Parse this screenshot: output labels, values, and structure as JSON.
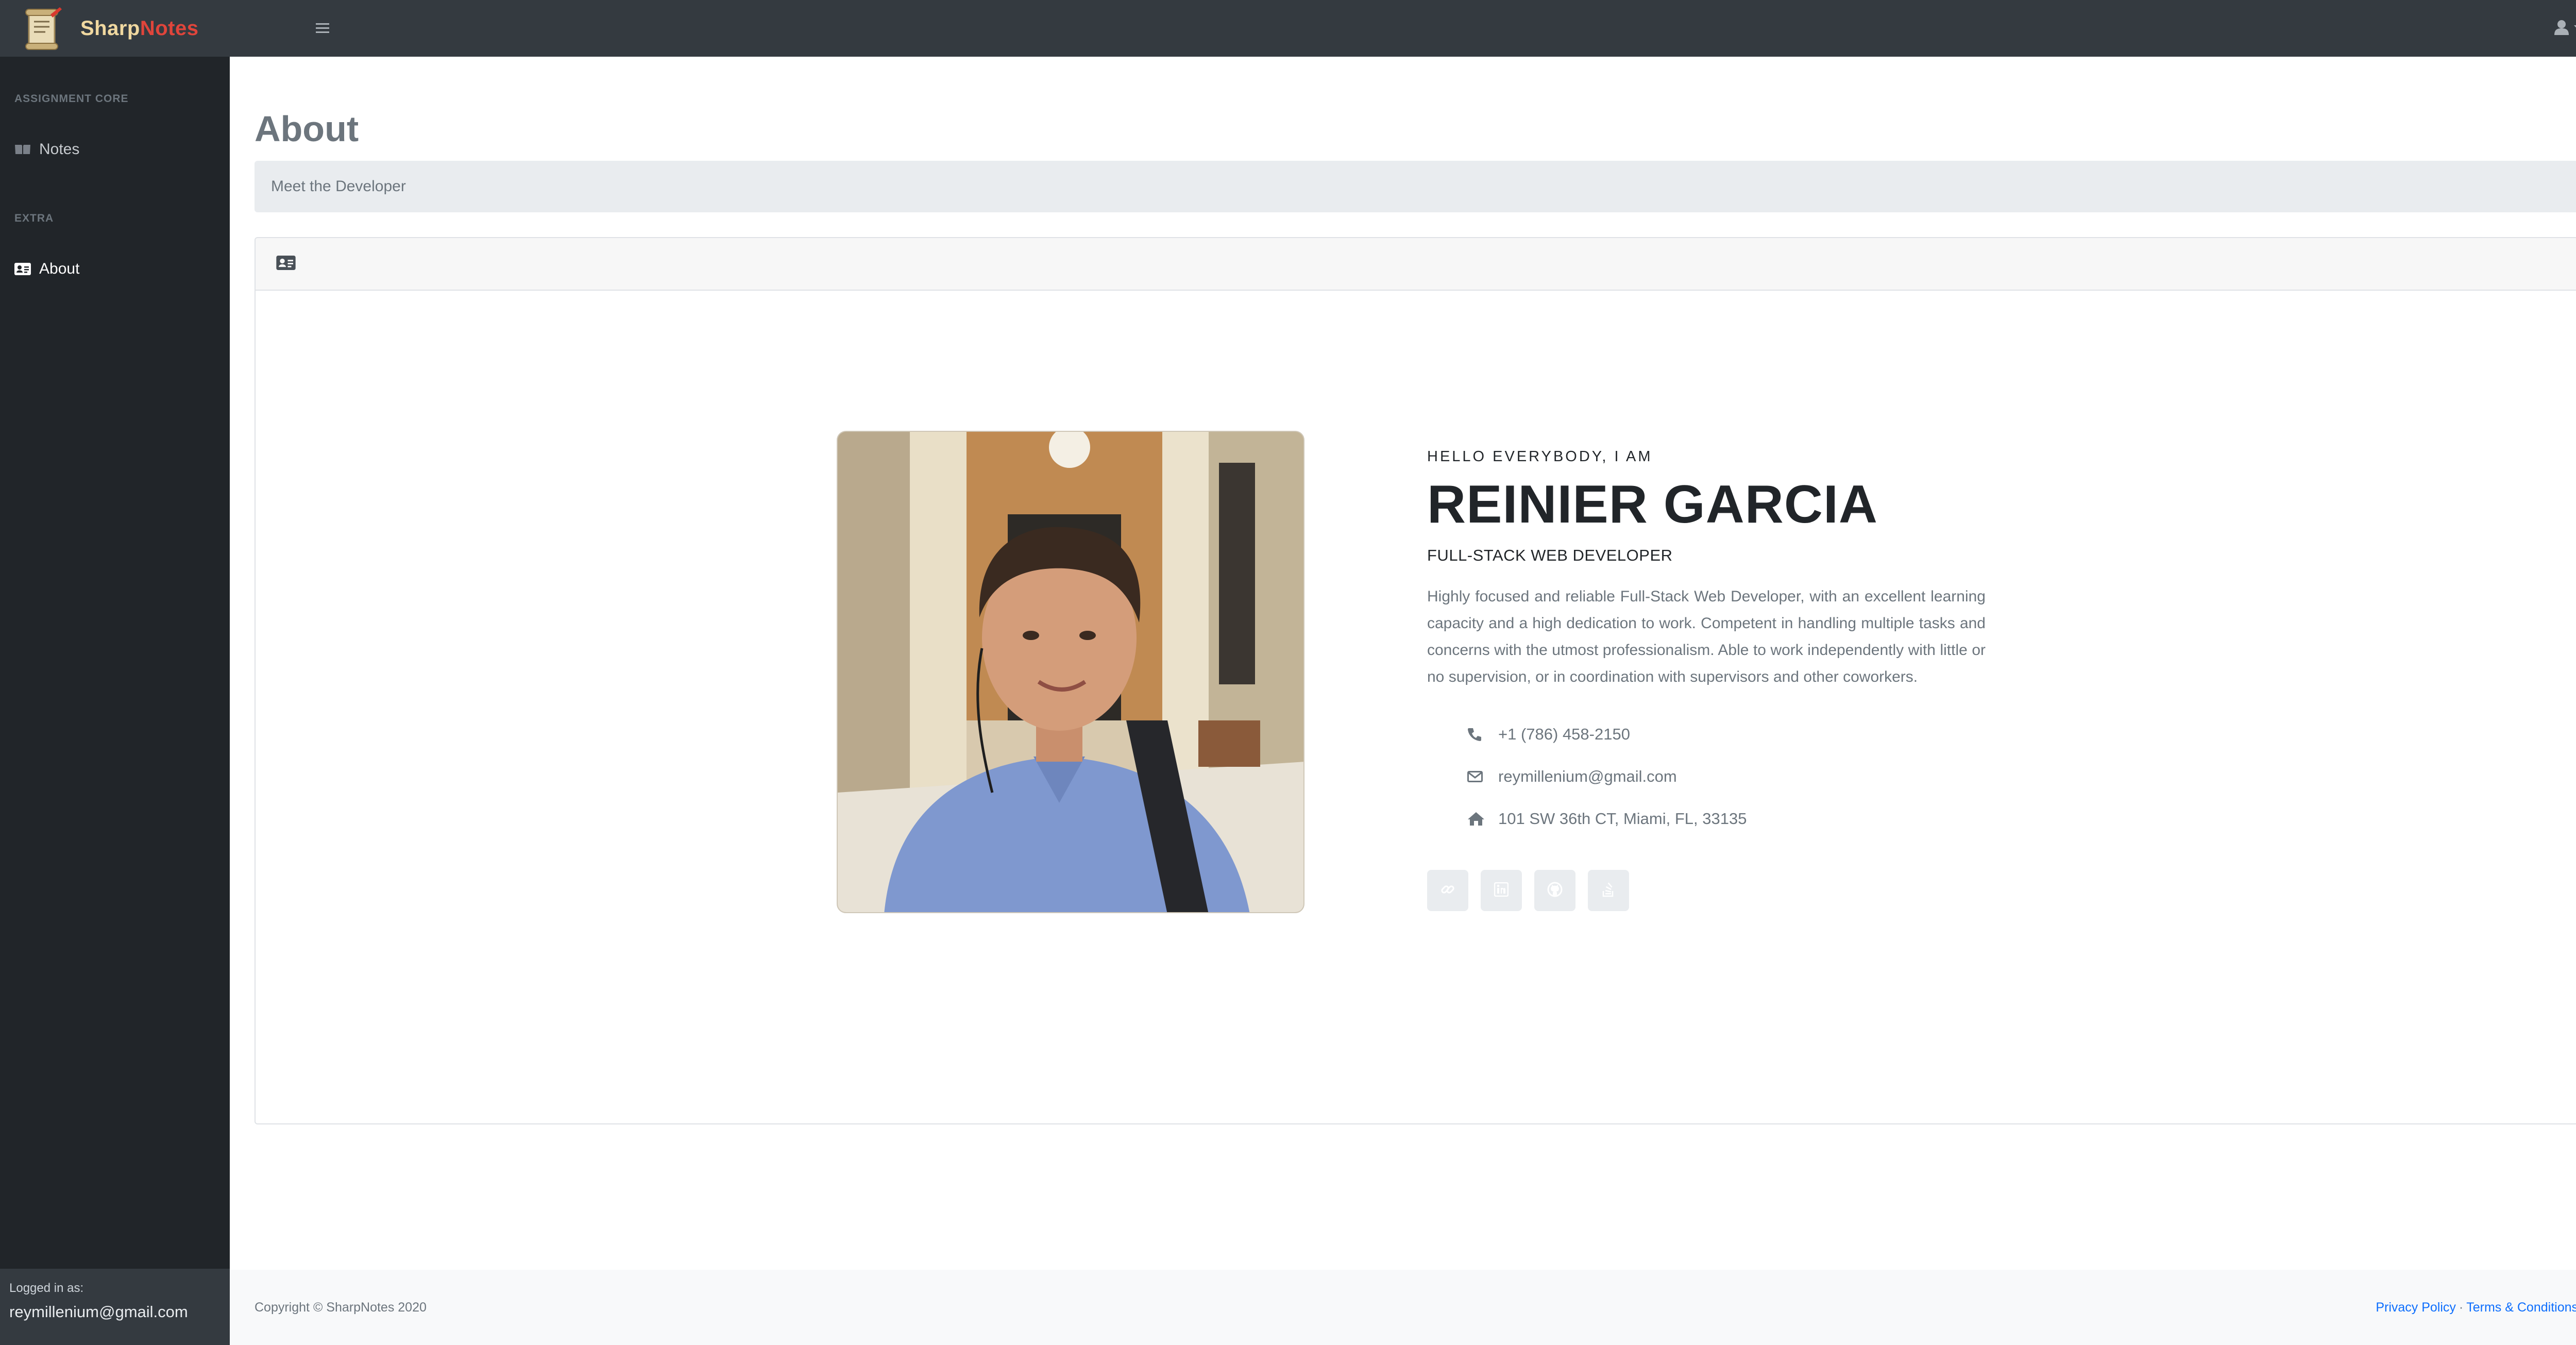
{
  "app": {
    "brand_part1": "Sharp",
    "brand_part2": "Notes",
    "brand_color_1": "#f0d8a0",
    "brand_color_2": "#e0453b",
    "icons": [
      "scroll-logo-icon",
      "hamburger-icon",
      "user-icon",
      "caret-down-icon"
    ]
  },
  "sidebar": {
    "section1": "ASSIGNMENT CORE",
    "section2": "EXTRA",
    "items": [
      {
        "label": "Notes",
        "icon": "book-icon"
      },
      {
        "label": "About",
        "icon": "id-card-icon",
        "active": true
      }
    ],
    "logged_label": "Logged in as:",
    "logged_user": "reymillenium@gmail.com"
  },
  "page": {
    "title": "About",
    "breadcrumb": "Meet the Developer",
    "card_header_icon": "id-card-icon"
  },
  "profile": {
    "greeting": "HELLO EVERYBODY, I AM",
    "name": "REINIER GARCIA",
    "role": "FULL-STACK WEB DEVELOPER",
    "description": "Highly focused and reliable Full-Stack Web Developer, with an excellent learning capacity and a high dedication to work. Competent in handling multiple tasks and concerns with the utmost professionalism. Able to work independently with little or no supervision, or in coordination with supervisors and other coworkers.",
    "phone": "+1 (786) 458-2150",
    "email": "reymillenium@gmail.com",
    "address": "101 SW 36th CT, Miami, FL, 33135",
    "socials": [
      "link-icon",
      "linkedin-icon",
      "github-icon",
      "stackoverflow-icon"
    ]
  },
  "footer": {
    "copyright": "Copyright © SharpNotes 2020",
    "privacy": "Privacy Policy",
    "separator": "·",
    "terms": "Terms & Conditions"
  }
}
